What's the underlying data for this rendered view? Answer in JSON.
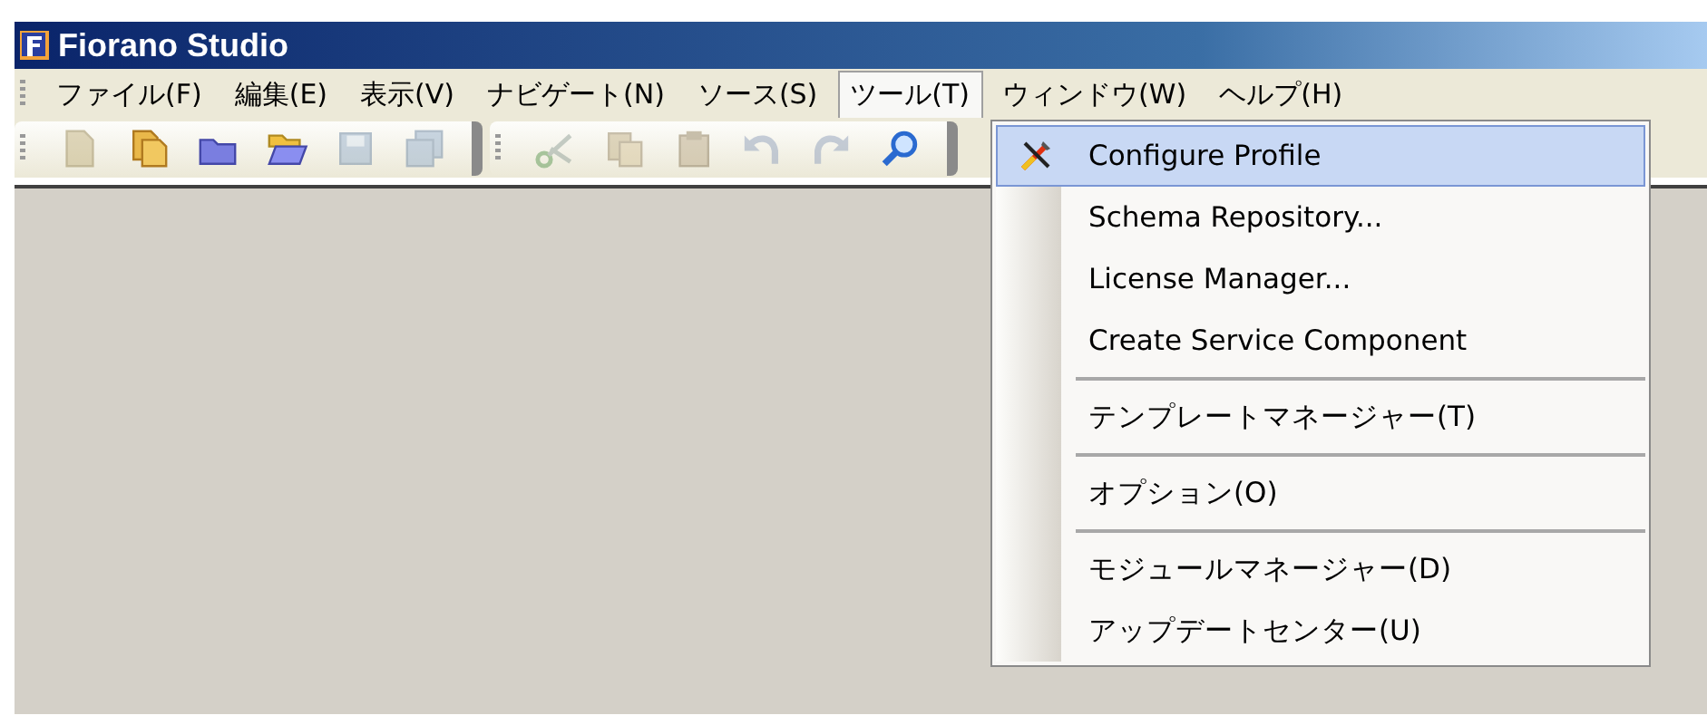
{
  "window": {
    "title": "Fiorano Studio"
  },
  "menu_bar": [
    {
      "label": "ファイル(F)",
      "selected": false
    },
    {
      "label": "編集(E)",
      "selected": false
    },
    {
      "label": "表示(V)",
      "selected": false
    },
    {
      "label": "ナビゲート(N)",
      "selected": false
    },
    {
      "label": "ソース(S)",
      "selected": false
    },
    {
      "label": "ツール(T)",
      "selected": true
    },
    {
      "label": "ウィンドウ(W)",
      "selected": false
    },
    {
      "label": "ヘルプ(H)",
      "selected": false
    }
  ],
  "toolbars": [
    {
      "buttons": [
        {
          "kind": "new-file",
          "disabled": true
        },
        {
          "kind": "new-project",
          "disabled": false
        },
        {
          "kind": "folder",
          "disabled": false
        },
        {
          "kind": "open-folder",
          "disabled": false
        },
        {
          "kind": "save",
          "disabled": true
        },
        {
          "kind": "save-all",
          "disabled": true
        }
      ]
    },
    {
      "buttons": [
        {
          "kind": "cut",
          "disabled": true
        },
        {
          "kind": "copy",
          "disabled": true
        },
        {
          "kind": "paste",
          "disabled": true
        },
        {
          "kind": "undo",
          "disabled": true
        },
        {
          "kind": "redo",
          "disabled": true
        },
        {
          "kind": "find",
          "disabled": false
        }
      ]
    }
  ],
  "tools_menu": [
    {
      "kind": "item",
      "label": "Configure Profile",
      "selected": true,
      "icon": true
    },
    {
      "kind": "item",
      "label": "Schema Repository...",
      "selected": false,
      "icon": false
    },
    {
      "kind": "item",
      "label": "License Manager...",
      "selected": false,
      "icon": false
    },
    {
      "kind": "item",
      "label": "Create Service Component",
      "selected": false,
      "icon": false
    },
    {
      "kind": "separator"
    },
    {
      "kind": "item",
      "label": "テンプレートマネージャー(T)",
      "selected": false,
      "icon": false
    },
    {
      "kind": "separator"
    },
    {
      "kind": "item",
      "label": "オプション(O)",
      "selected": false,
      "icon": false
    },
    {
      "kind": "separator"
    },
    {
      "kind": "item",
      "label": "モジュールマネージャー(D)",
      "selected": false,
      "icon": false
    },
    {
      "kind": "item",
      "label": "アップデートセンター(U)",
      "selected": false,
      "icon": false
    }
  ]
}
